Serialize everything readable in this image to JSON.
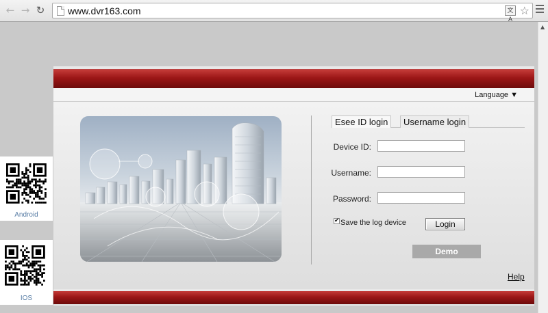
{
  "browser": {
    "url": "www.dvr163.com",
    "back_icon": "arrow-left-icon",
    "forward_icon": "arrow-right-icon",
    "reload_icon": "reload-icon",
    "translate_glyph": "文A",
    "star_glyph": "☆"
  },
  "header": {
    "language_label": "Language ▼"
  },
  "login": {
    "tabs": [
      {
        "label": "Esee ID login"
      },
      {
        "label": "Username login"
      }
    ],
    "fields": {
      "device_id_label": "Device ID:",
      "device_id_value": "",
      "username_label": "Username:",
      "username_value": "",
      "password_label": "Password:",
      "password_value": ""
    },
    "save_checked": true,
    "save_label": "Save the log device",
    "login_button": "Login",
    "demo_button": "Demo",
    "help_link": "Help"
  },
  "qr": {
    "android_label": "Android",
    "ios_label": "IOS"
  },
  "colors": {
    "brand_red": "#9b1616",
    "link_blue": "#5a7ea6",
    "demo_gray": "#a9a9a9"
  }
}
